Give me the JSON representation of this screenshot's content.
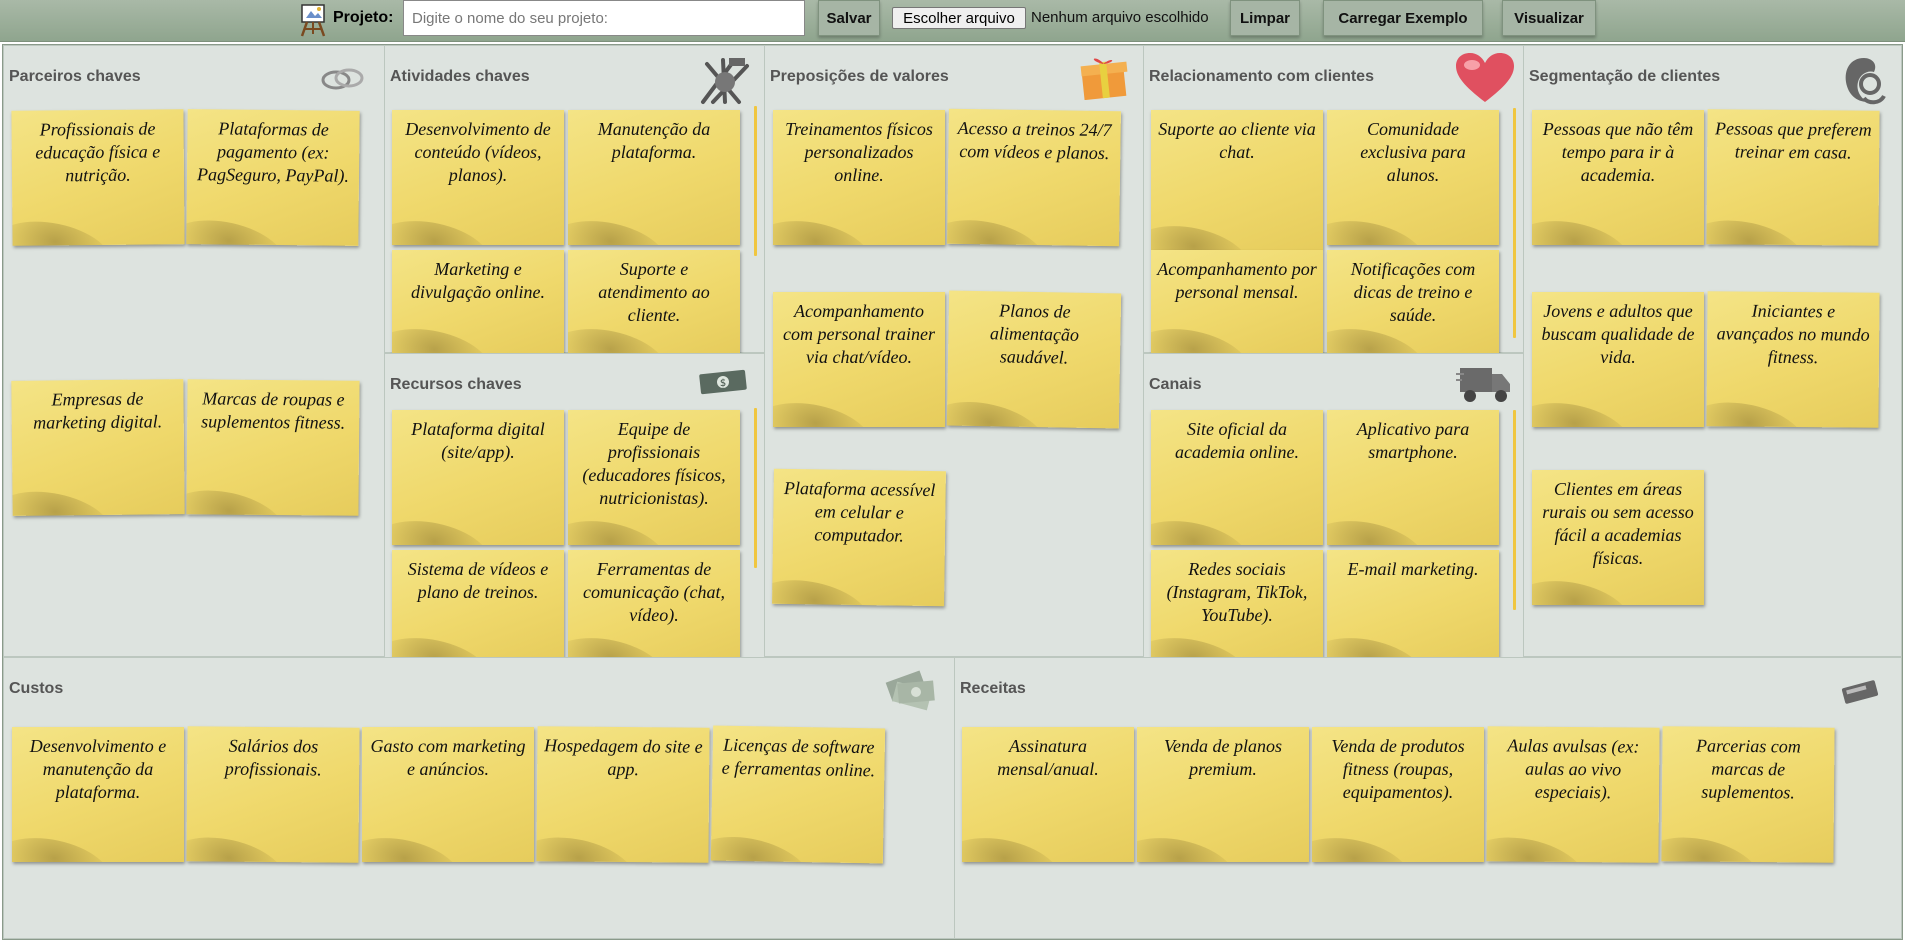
{
  "toolbar": {
    "project_label": "Projeto:",
    "project_placeholder": "Digite o nome do seu projeto:",
    "save_label": "Salvar",
    "file_button_label": "Escolher arquivo",
    "file_status": "Nenhum arquivo escolhido",
    "clear_label": "Limpar",
    "load_example_label": "Carregar Exemplo",
    "view_label": "Visualizar"
  },
  "blocks": {
    "partners": {
      "title": "Parceiros chaves",
      "icon": "rings-icon",
      "notes": [
        "Profissionais de educação física e nutrição.",
        "Plataformas de pagamento (ex: PagSeguro, PayPal).",
        "Empresas de marketing digital.",
        "Marcas de roupas e suplementos fitness."
      ]
    },
    "activities": {
      "title": "Atividades chaves",
      "icon": "tools-icon",
      "notes": [
        "Desenvolvimento de conteúdo (vídeos, planos).",
        "Manutenção da plataforma.",
        "Marketing e divulgação online.",
        "Suporte e atendimento ao cliente."
      ]
    },
    "resources": {
      "title": "Recursos chaves",
      "icon": "money-icon",
      "notes": [
        "Plataforma digital (site/app).",
        "Equipe de profissionais (educadores físicos, nutricionistas).",
        "Sistema de vídeos e plano de treinos.",
        "Ferramentas de comunicação (chat, vídeo)."
      ]
    },
    "value": {
      "title": "Preposições de valores",
      "icon": "gift-icon",
      "notes": [
        "Treinamentos físicos personalizados online.",
        "Acesso a treinos 24/7 com vídeos e planos.",
        "Acompanhamento com personal trainer via chat/vídeo.",
        "Planos de alimentação saudável.",
        "Plataforma acessível em celular e computador."
      ]
    },
    "relationship": {
      "title": "Relacionamento com clientes",
      "icon": "heart-icon",
      "notes": [
        "Suporte ao cliente via chat.",
        "Comunidade exclusiva para alunos.",
        "Acompanhamento por personal mensal.",
        "Notificações com dicas de treino e saúde."
      ]
    },
    "channels": {
      "title": "Canais",
      "icon": "truck-icon",
      "notes": [
        "Site oficial da academia online.",
        "Aplicativo para smartphone.",
        "Redes sociais (Instagram, TikTok, YouTube).",
        "E-mail marketing."
      ]
    },
    "segments": {
      "title": "Segmentação de clientes",
      "icon": "mother-child-icon",
      "notes": [
        "Pessoas que não têm tempo para ir à academia.",
        "Pessoas que preferem treinar em casa.",
        "Jovens e adultos que buscam qualidade de vida.",
        "Iniciantes e avançados no mundo fitness.",
        "Clientes em áreas rurais ou sem acesso fácil a academias físicas."
      ]
    },
    "costs": {
      "title": "Custos",
      "icon": "cash-stack-icon",
      "notes": [
        "Desenvolvimento e manutenção da plataforma.",
        "Salários dos profissionais.",
        "Gasto com marketing e anúncios.",
        "Hospedagem do site e app.",
        "Licenças de software e ferramentas online."
      ]
    },
    "revenue": {
      "title": "Receitas",
      "icon": "card-reader-icon",
      "notes": [
        "Assinatura mensal/anual.",
        "Venda de planos premium.",
        "Venda de produtos fitness (roupas, equipamentos).",
        "Aulas avulsas (ex: aulas ao vivo especiais).",
        "Parcerias com marcas de suplementos."
      ]
    }
  }
}
